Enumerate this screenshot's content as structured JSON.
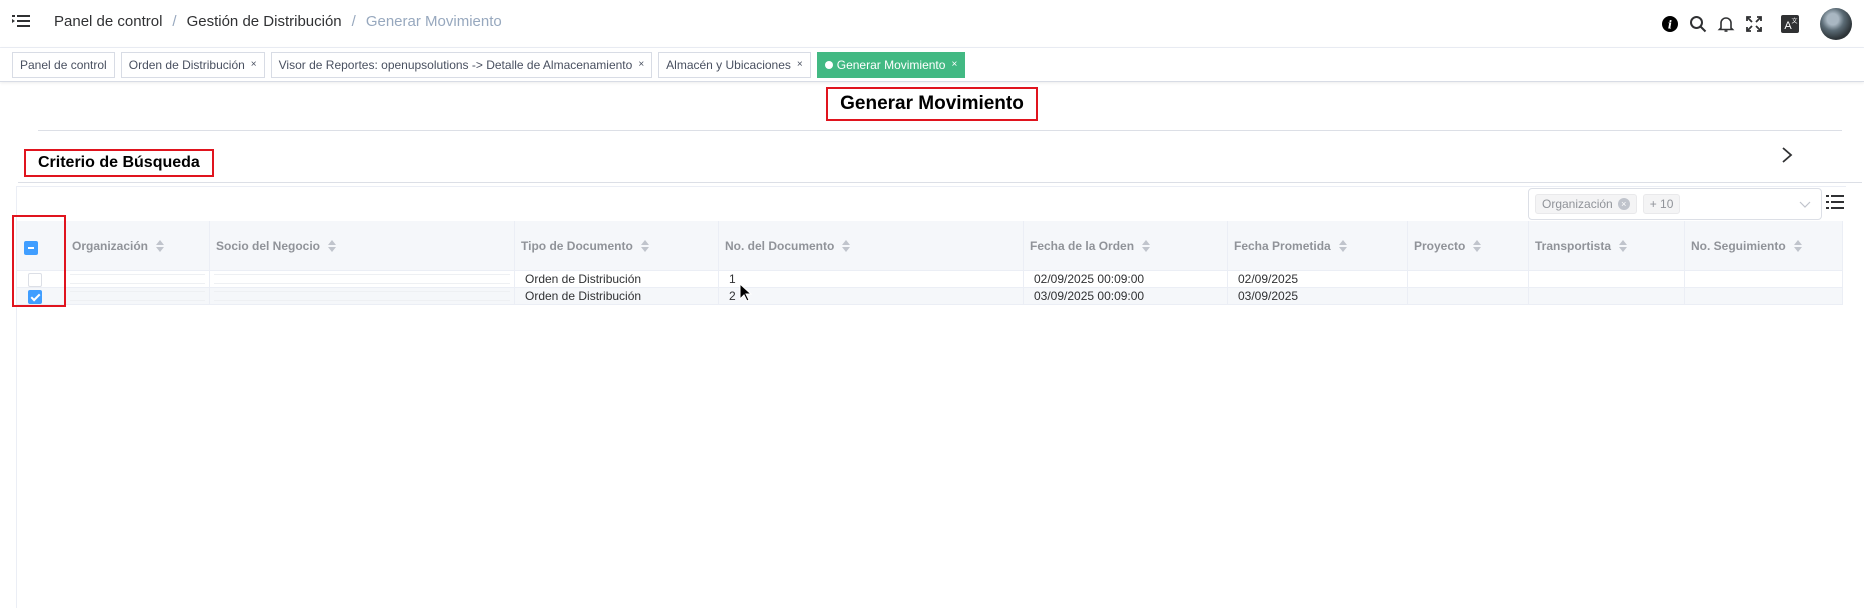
{
  "navbar": {
    "breadcrumb": [
      "Panel de control",
      "Gestión de Distribución",
      "Generar Movimiento"
    ],
    "icons": [
      "info-icon",
      "search-icon",
      "bell-icon",
      "fullscreen-icon",
      "language-icon",
      "avatar"
    ]
  },
  "tags": [
    {
      "label": "Panel de control",
      "closable": false,
      "active": false
    },
    {
      "label": "Orden de Distribución",
      "closable": true,
      "active": false
    },
    {
      "label": "Visor de Reportes: openupsolutions -> Detalle de Almacenamiento",
      "closable": true,
      "active": false
    },
    {
      "label": "Almacén y Ubicaciones",
      "closable": true,
      "active": false
    },
    {
      "label": "Generar Movimiento",
      "closable": true,
      "active": true
    }
  ],
  "close_glyph": "×",
  "page_title": "Generar Movimiento",
  "criteria_title": "Criterio de Búsqueda",
  "column_selector": {
    "tag": "Organización",
    "more": "+ 10"
  },
  "table": {
    "columns": [
      "Organización",
      "Socio del Negocio",
      "Tipo de Documento",
      "No. del Documento",
      "Fecha de la Orden",
      "Fecha Prometida",
      "Proyecto",
      "Transportista",
      "No. Seguimiento"
    ],
    "rows": [
      {
        "checked": false,
        "organizacion": "",
        "socio": "",
        "tipo": "Orden de Distribución",
        "numero": "1",
        "fecha_orden": "02/09/2025 00:09:00",
        "fecha_prometida": "02/09/2025",
        "proyecto": "",
        "transportista": "",
        "seguimiento": ""
      },
      {
        "checked": true,
        "organizacion": "",
        "socio": "",
        "tipo": "Orden de Distribución",
        "numero": "2",
        "fecha_orden": "03/09/2025 00:09:00",
        "fecha_prometida": "03/09/2025",
        "proyecto": "",
        "transportista": "",
        "seguimiento": ""
      }
    ]
  },
  "colors": {
    "active_tag": "#42b983",
    "checkbox": "#409eff",
    "highlight": "#e0141e"
  }
}
